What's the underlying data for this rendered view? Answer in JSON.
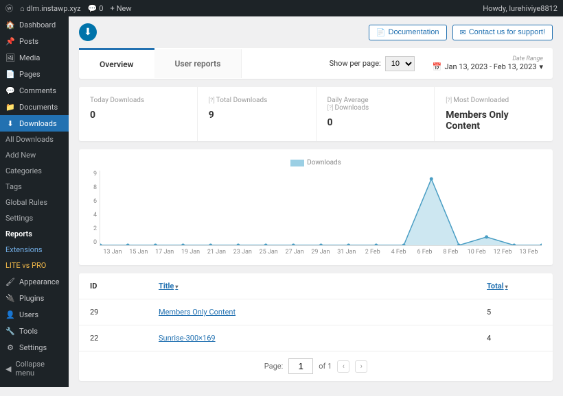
{
  "adminbar": {
    "site_name": "dlm.instawp.xyz",
    "comment_count": "0",
    "new_label": "New",
    "howdy": "Howdy, lurehiviye8812"
  },
  "sidebar": {
    "items": [
      {
        "label": "Dashboard",
        "icon": "🏠"
      },
      {
        "label": "Posts",
        "icon": "📌"
      },
      {
        "label": "Media",
        "icon": "🖼"
      },
      {
        "label": "Pages",
        "icon": "📄"
      },
      {
        "label": "Comments",
        "icon": "💬"
      },
      {
        "label": "Documents",
        "icon": "📁"
      },
      {
        "label": "Downloads",
        "icon": "⬇"
      }
    ],
    "subitems": [
      "All Downloads",
      "Add New",
      "Categories",
      "Tags",
      "Global Rules",
      "Settings",
      "Reports",
      "Extensions",
      "LITE vs PRO"
    ],
    "items2": [
      {
        "label": "Appearance",
        "icon": "🖌"
      },
      {
        "label": "Plugins",
        "icon": "🔌"
      },
      {
        "label": "Users",
        "icon": "👤"
      },
      {
        "label": "Tools",
        "icon": "🔧"
      },
      {
        "label": "Settings",
        "icon": "⚙"
      }
    ],
    "collapse": "Collapse menu"
  },
  "header": {
    "doc_btn": "Documentation",
    "support_btn": "Contact us for support!"
  },
  "tabs": {
    "overview": "Overview",
    "user_reports": "User reports",
    "per_page_label": "Show per page:",
    "per_page_value": "10",
    "date_range_label": "Date Range",
    "date_range_value": "Jan 13, 2023 - Feb 13, 2023"
  },
  "stats": {
    "today_label": "Today Downloads",
    "today_value": "0",
    "total_label": "Total Downloads",
    "total_value": "9",
    "avg_label_line1": "Daily Average",
    "avg_label_line2": "Downloads",
    "avg_value": "0",
    "most_label": "Most Downloaded",
    "most_value": "Members Only Content"
  },
  "chart_data": {
    "type": "line",
    "title": "",
    "legend": "Downloads",
    "ylabel": "",
    "xlabel": "",
    "ylim": [
      0,
      9
    ],
    "yticks": [
      0,
      2,
      4,
      6,
      8,
      9
    ],
    "categories": [
      "13 Jan",
      "15 Jan",
      "17 Jan",
      "19 Jan",
      "21 Jan",
      "23 Jan",
      "25 Jan",
      "27 Jan",
      "29 Jan",
      "31 Jan",
      "2 Feb",
      "4 Feb",
      "6 Feb",
      "8 Feb",
      "10 Feb",
      "12 Feb",
      "13 Feb"
    ],
    "series": [
      {
        "name": "Downloads",
        "color": "#6fb9d6",
        "values": [
          0,
          0,
          0,
          0,
          0,
          0,
          0,
          0,
          0,
          0,
          0,
          0,
          8,
          0,
          1,
          0,
          0
        ]
      }
    ]
  },
  "table": {
    "headers": {
      "id": "ID",
      "title": "Title",
      "total": "Total"
    },
    "rows": [
      {
        "id": "29",
        "title": "Members Only Content",
        "total": "5"
      },
      {
        "id": "22",
        "title": "Sunrise-300×169",
        "total": "4"
      }
    ],
    "pager": {
      "page_label": "Page:",
      "page_value": "1",
      "of_label": "of 1"
    }
  }
}
